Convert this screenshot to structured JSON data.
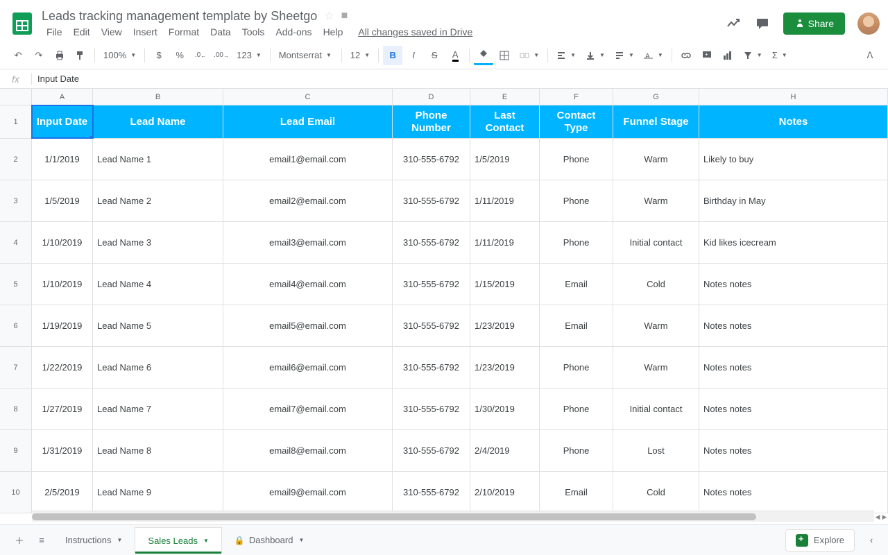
{
  "doc": {
    "title": "Leads tracking management template by Sheetgo"
  },
  "menus": {
    "file": "File",
    "edit": "Edit",
    "view": "View",
    "insert": "Insert",
    "format": "Format",
    "data": "Data",
    "tools": "Tools",
    "addons": "Add-ons",
    "help": "Help",
    "saved": "All changes saved in Drive"
  },
  "share": {
    "label": "Share"
  },
  "toolbar": {
    "zoom": "100%",
    "dollar": "$",
    "percent": "%",
    "dec_dec": ".0",
    "inc_dec": ".00",
    "numfmt": "123",
    "font": "Montserrat",
    "size": "12"
  },
  "formula": {
    "fx": "fx",
    "value": "Input Date"
  },
  "cols": [
    "A",
    "B",
    "C",
    "D",
    "E",
    "F",
    "G",
    "H"
  ],
  "headers": {
    "A": "Input Date",
    "B": "Lead Name",
    "C": "Lead Email",
    "D": "Phone Number",
    "E": "Last Contact",
    "F": "Contact Type",
    "G": "Funnel Stage",
    "H": "Notes"
  },
  "rows": [
    {
      "n": "2",
      "A": "1/1/2019",
      "B": "Lead Name 1",
      "C": "email1@email.com",
      "D": "310-555-6792",
      "E": "1/5/2019",
      "F": "Phone",
      "G": "Warm",
      "H": "Likely to buy"
    },
    {
      "n": "3",
      "A": "1/5/2019",
      "B": "Lead Name 2",
      "C": "email2@email.com",
      "D": "310-555-6792",
      "E": "1/11/2019",
      "F": "Phone",
      "G": "Warm",
      "H": "Birthday in May"
    },
    {
      "n": "4",
      "A": "1/10/2019",
      "B": "Lead Name 3",
      "C": "email3@email.com",
      "D": "310-555-6792",
      "E": "1/11/2019",
      "F": "Phone",
      "G": "Initial contact",
      "H": "Kid likes icecream"
    },
    {
      "n": "5",
      "A": "1/10/2019",
      "B": "Lead Name 4",
      "C": "email4@email.com",
      "D": "310-555-6792",
      "E": "1/15/2019",
      "F": "Email",
      "G": "Cold",
      "H": "Notes notes"
    },
    {
      "n": "6",
      "A": "1/19/2019",
      "B": "Lead Name 5",
      "C": "email5@email.com",
      "D": "310-555-6792",
      "E": "1/23/2019",
      "F": "Email",
      "G": "Warm",
      "H": "Notes notes"
    },
    {
      "n": "7",
      "A": "1/22/2019",
      "B": "Lead Name 6",
      "C": "email6@email.com",
      "D": "310-555-6792",
      "E": "1/23/2019",
      "F": "Phone",
      "G": "Warm",
      "H": "Notes notes"
    },
    {
      "n": "8",
      "A": "1/27/2019",
      "B": "Lead Name 7",
      "C": "email7@email.com",
      "D": "310-555-6792",
      "E": "1/30/2019",
      "F": "Phone",
      "G": "Initial contact",
      "H": "Notes notes"
    },
    {
      "n": "9",
      "A": "1/31/2019",
      "B": "Lead Name 8",
      "C": "email8@email.com",
      "D": "310-555-6792",
      "E": "2/4/2019",
      "F": "Phone",
      "G": "Lost",
      "H": "Notes notes"
    },
    {
      "n": "10",
      "A": "2/5/2019",
      "B": "Lead Name 9",
      "C": "email9@email.com",
      "D": "310-555-6792",
      "E": "2/10/2019",
      "F": "Email",
      "G": "Cold",
      "H": "Notes notes"
    }
  ],
  "tabs": {
    "instructions": "Instructions",
    "salesleads": "Sales Leads",
    "dashboard": "Dashboard"
  },
  "explore": "Explore"
}
